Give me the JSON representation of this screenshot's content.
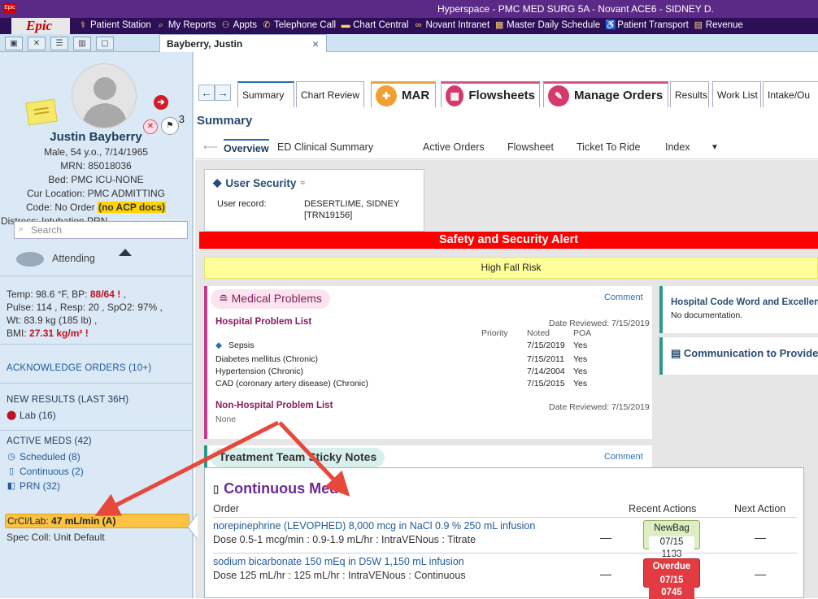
{
  "titlebar": {
    "title": "Hyperspace - PMC MED SURG 5A - Novant ACE6 - SIDNEY D.",
    "logo": "Epic"
  },
  "menubar": {
    "logo": "Epic",
    "items": [
      {
        "label": "Patient Station",
        "icon": "patient-station-icon"
      },
      {
        "label": "My Reports",
        "icon": "search-icon"
      },
      {
        "label": "Appts",
        "icon": "appointments-icon"
      },
      {
        "label": "Telephone Call",
        "icon": "phone-icon"
      },
      {
        "label": "Chart Central",
        "icon": "folder-icon"
      },
      {
        "label": "Novant Intranet",
        "icon": "binoculars-icon"
      },
      {
        "label": "Master Daily Schedule",
        "icon": "calendar-icon"
      },
      {
        "label": "Patient Transport",
        "icon": "transport-icon"
      },
      {
        "label": "Revenue",
        "icon": "report-icon"
      }
    ]
  },
  "tabrow": {
    "patient_tab": "Bayberry, Justin",
    "close": "×"
  },
  "patient": {
    "name": "Justin Bayberry",
    "demo": "Male, 54 y.o., 7/14/1965",
    "mrn": "MRN: 85018036",
    "bed": "Bed: PMC ICU-NONE",
    "location": "Cur Location: PMC ADMITTING",
    "code_prefix": "Code: No Order ",
    "code_highlight": "(no ACP docs)",
    "distress": "Distress: Intubation PRN",
    "flag_count": "3"
  },
  "search": {
    "placeholder": "Search"
  },
  "attending": "Attending",
  "vitals": {
    "temp_label": "Temp: 98.6 °F,  BP: ",
    "bp": "88/64",
    "pulse_line": "Pulse: 114 ,  Resp: 20 ,  SpO2: 97% ,",
    "wt_line": "Wt: 83.9 kg (185 lb) ,",
    "bmi_label": "BMI: ",
    "bmi": "27.31 kg/m²",
    "alert_mark": "!"
  },
  "sections": {
    "ack": "ACKNOWLEDGE ORDERS (10+)",
    "new_results": "NEW RESULTS (LAST 36H)",
    "lab": "Lab (16)",
    "active_meds": "ACTIVE MEDS (42)",
    "scheduled": "Scheduled (8)",
    "continuous": "Continuous (2)",
    "prn": "PRN (32)",
    "crcl_label": "CrCl/Lab: ",
    "crcl_value": "47 mL/min (A)",
    "spec": "Spec Coll: Unit Default"
  },
  "activity_tabs": [
    {
      "label": "Summary"
    },
    {
      "label": "Chart Review"
    },
    {
      "label": "MAR"
    },
    {
      "label": "Flowsheets"
    },
    {
      "label": "Manage Orders"
    },
    {
      "label": "Results"
    },
    {
      "label": "Work List"
    },
    {
      "label": "Intake/Ou"
    }
  ],
  "page_title": "Summary",
  "subtabs": [
    "Overview",
    "ED Clinical Summary",
    "Active Orders",
    "Flowsheet",
    "Ticket To Ride",
    "Index"
  ],
  "user_security": {
    "title": "User Security",
    "row_label": "User record:",
    "row_value1": "DESERTLIME, SIDNEY",
    "row_value2": "[TRN19156]"
  },
  "safety_alert": "Safety and Security Alert",
  "fall_risk": "High Fall Risk",
  "medical_problems": {
    "title": "Medical Problems",
    "comment": "Comment",
    "hpl_title": "Hospital Problem List",
    "date_reviewed": "Date Reviewed: 7/15/2019",
    "cols": {
      "priority": "Priority",
      "noted": "Noted",
      "poa": "POA"
    },
    "rows": [
      {
        "name": "Sepsis",
        "noted": "7/15/2019",
        "poa": "Yes"
      },
      {
        "name": "Diabetes mellitus (Chronic)",
        "noted": "7/15/2011",
        "poa": "Yes"
      },
      {
        "name": "Hypertension (Chronic)",
        "noted": "7/14/2004",
        "poa": "Yes"
      },
      {
        "name": "CAD (coronary artery disease) (Chronic)",
        "noted": "7/15/2015",
        "poa": "Yes"
      }
    ],
    "nhpl_title": "Non-Hospital Problem List",
    "nhpl_date": "Date Reviewed: 7/15/2019",
    "nhpl_none": "None"
  },
  "sticky": {
    "title": "Treatment Team Sticky Notes",
    "comment": "Comment"
  },
  "right_cards": {
    "code_word_title": "Hospital Code Word and Excellen",
    "code_word_body": "No documentation.",
    "comm_title": "Communication to Provide"
  },
  "continuous_meds": {
    "title": "Continuous Meds",
    "cols": {
      "order": "Order",
      "recent": "Recent Actions",
      "next": "Next Action"
    },
    "rows": [
      {
        "name": "norepinephrine (LEVOPHED) 8,000 mcg in NaCl 0.9 % 250 mL infusion",
        "dose": "Dose 0.5-1 mcg/min : 0.9-1.9 mL/hr : IntraVENous : Titrate",
        "dash": "—",
        "action": "NewBag",
        "action_time": "07/15 1133",
        "next": "—"
      },
      {
        "name": "sodium bicarbonate 150 mEq in D5W 1,150 mL infusion",
        "dose": "Dose 125 mL/hr : 125 mL/hr : IntraVENous : Continuous",
        "dash": "—",
        "action": "Overdue",
        "action_time": "07/15 0745",
        "next": "—"
      }
    ]
  },
  "colors": {
    "titlebar": "#5b2a86",
    "menubar": "#2d0f57",
    "alert": "#ff0000",
    "fall": "#ffff99",
    "annotation_arrow": "#e8473b"
  }
}
